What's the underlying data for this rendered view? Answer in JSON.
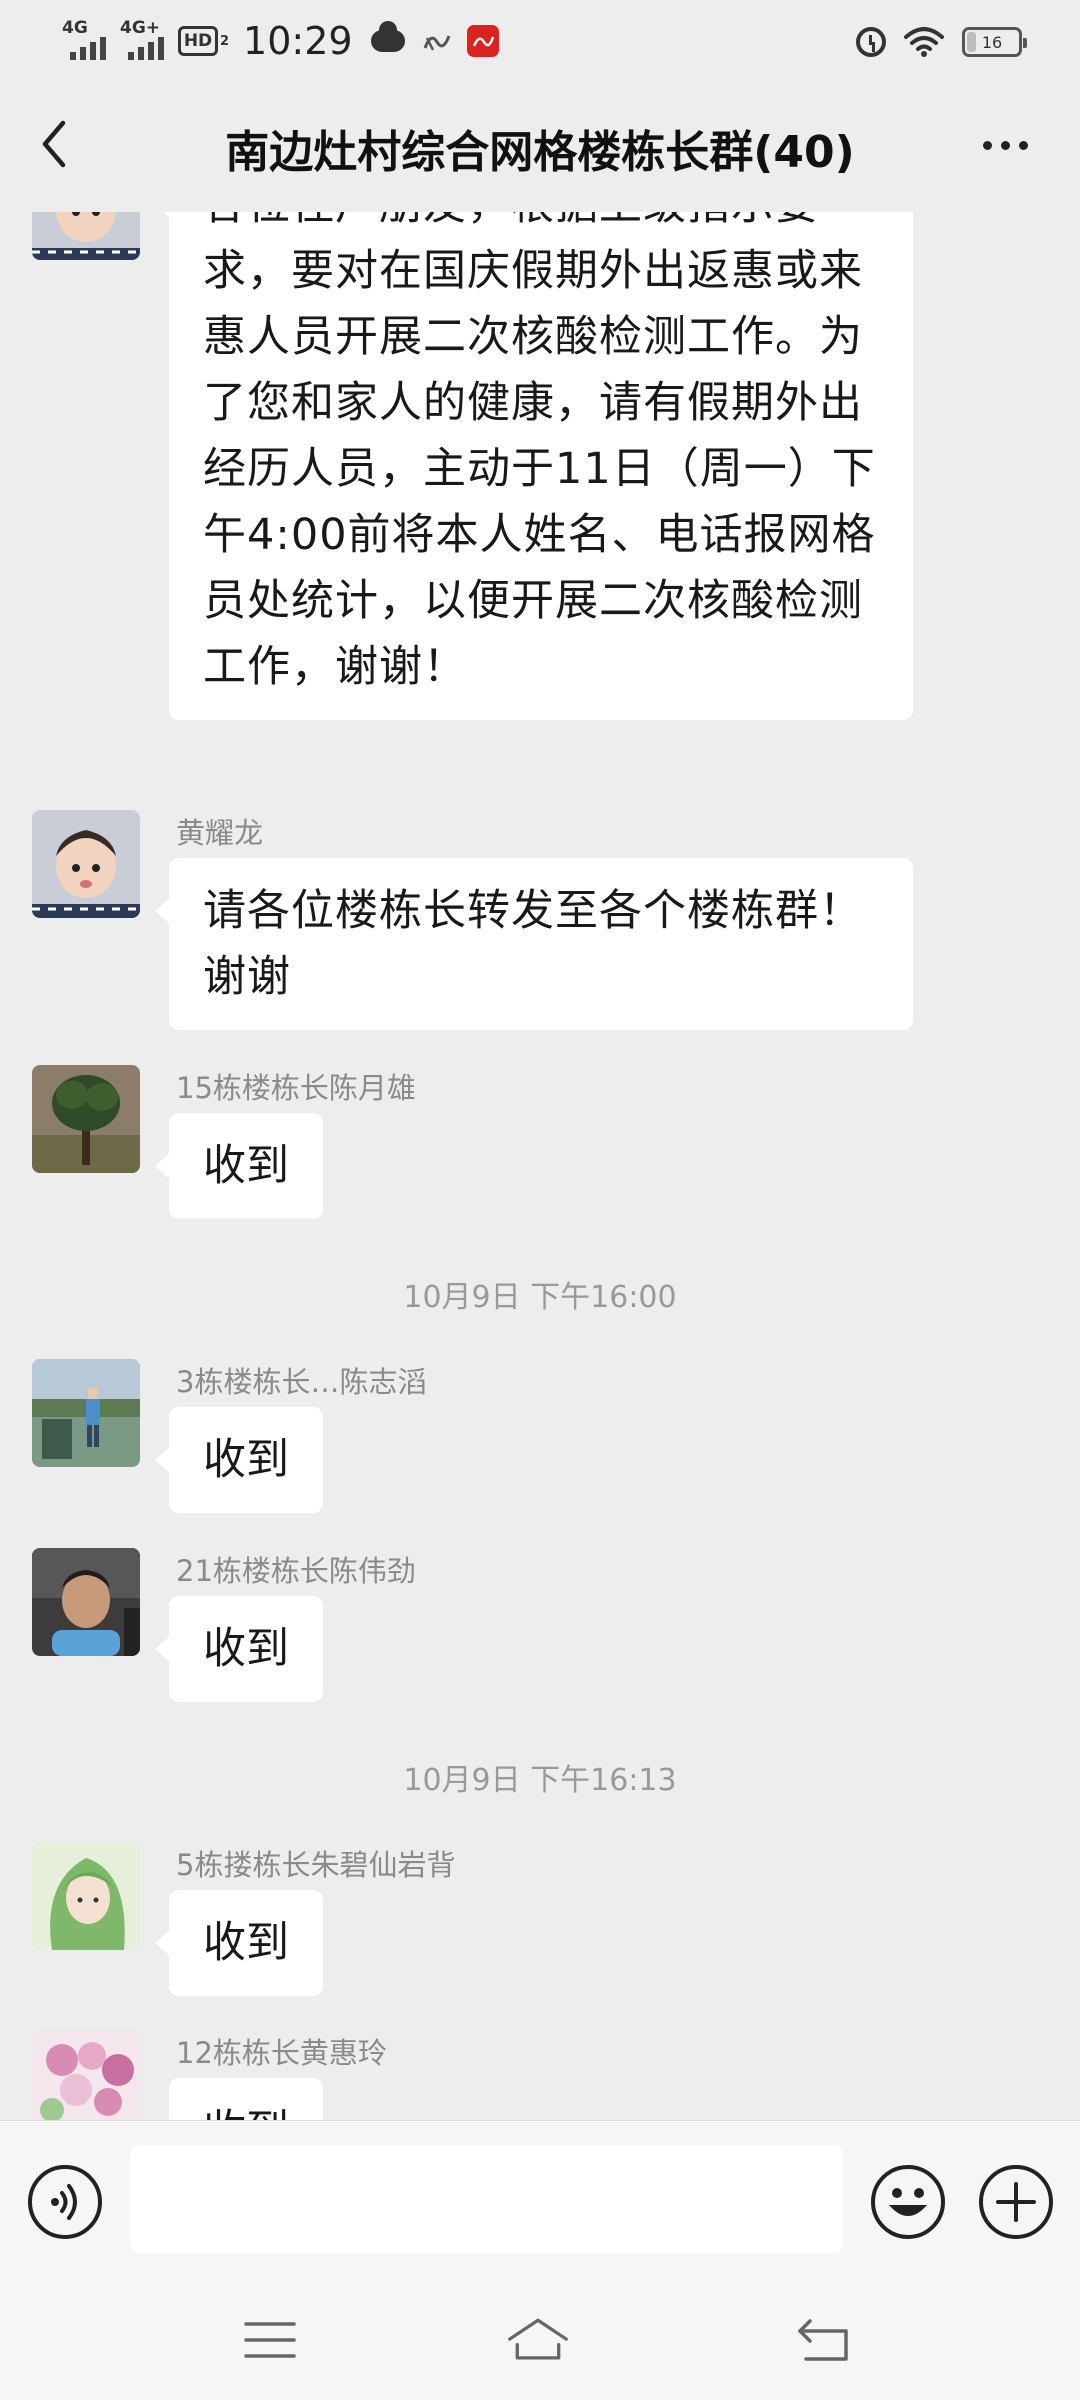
{
  "status_bar": {
    "network_1": "4G",
    "network_2": "4G+",
    "hd_label": "HD",
    "hd_sub": "2",
    "time": "10:29",
    "battery_percent": "16",
    "battery_level": 0.16
  },
  "nav": {
    "title": "南边灶村综合网格楼栋长群(40)"
  },
  "messages": [
    {
      "sender": "",
      "text": "各位住户朋友，根据上级指示要求，要对在国庆假期外出返惠或来惠人员开展二次核酸检测工作。为了您和家人的健康，请有假期外出经历人员，主动于11日（周一）下午4:00前将本人姓名、电话报网格员处统计，以便开展二次核酸检测工作，谢谢！"
    },
    {
      "sender": "黄耀龙",
      "text": "请各位楼栋长转发至各个楼栋群！谢谢"
    },
    {
      "sender": "15栋楼栋长陈月雄",
      "text": "收到"
    },
    {
      "timestamp": "10月9日 下午16:00"
    },
    {
      "sender": "3栋楼栋长…陈志滔",
      "text": "收到"
    },
    {
      "sender": "21栋楼栋长陈伟劲",
      "text": "收到"
    },
    {
      "timestamp": "10月9日 下午16:13"
    },
    {
      "sender": "5栋搂栋长朱碧仙岩背",
      "text": "收到"
    },
    {
      "sender": "12栋栋长黄惠玲",
      "text": "收到"
    }
  ],
  "input_bar": {
    "placeholder": ""
  },
  "icons": {
    "back": "back-arrow-icon",
    "more": "more-dots-icon",
    "voice": "voice-icon",
    "emoji": "emoji-icon",
    "plus": "plus-icon",
    "menu": "menu-icon",
    "home": "home-icon",
    "return": "return-icon"
  },
  "colors": {
    "background": "#EDEDED",
    "bubble": "#FFFFFF",
    "sender_text": "#8A8A8A",
    "badge_red": "#D9231C"
  }
}
